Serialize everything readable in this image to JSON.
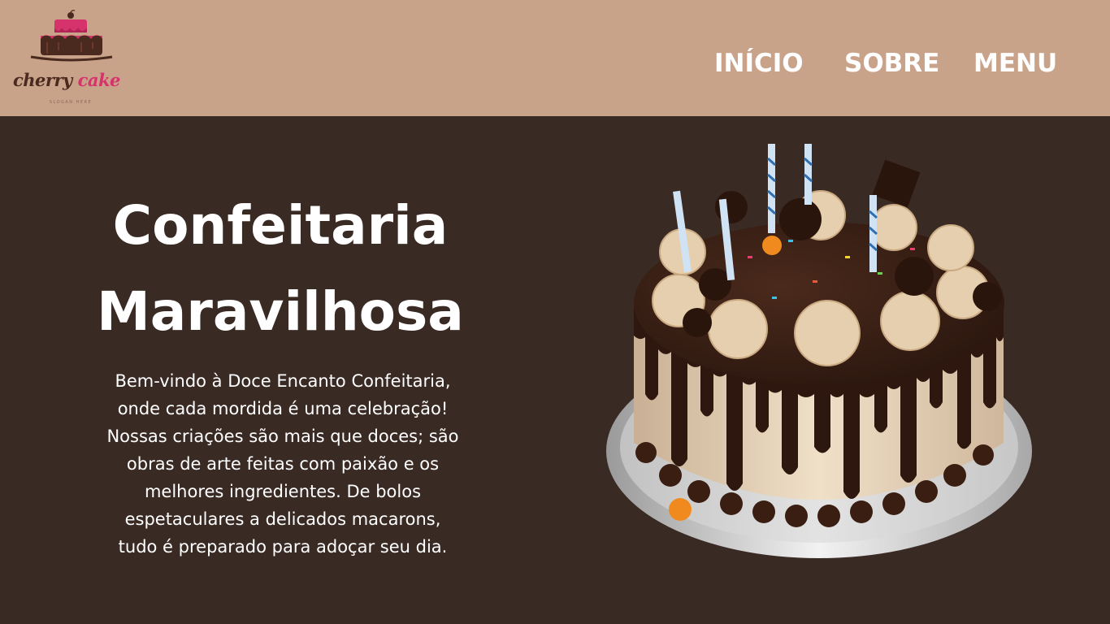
{
  "header": {
    "logo": {
      "word1": "cherry",
      "word2": "cake",
      "slogan": "SLOGAN HERE",
      "icon": "cake-logo-icon"
    },
    "nav": [
      {
        "label": "INÍCIO"
      },
      {
        "label": "SOBRE"
      },
      {
        "label": "MENU"
      }
    ]
  },
  "hero": {
    "title_line1": "Confeitaria",
    "title_line2": "Maravilhosa",
    "paragraph_lines": [
      "Bem-vindo à Doce Encanto Confeitaria,",
      "onde cada mordida é uma celebração!",
      "Nossas criações são mais que doces; são",
      "obras de arte feitas com paixão e os",
      "melhores ingredientes. De bolos",
      "espetaculares a delicados macarons,",
      "tudo é preparado para adoçar seu dia."
    ],
    "image": "chocolate-drip-cake-image"
  },
  "colors": {
    "header_bg": "#c9a28a",
    "page_bg": "#3a2a24",
    "text": "#ffffff",
    "brand_pink": "#d6336c",
    "brand_brown": "#4a2a1e"
  }
}
